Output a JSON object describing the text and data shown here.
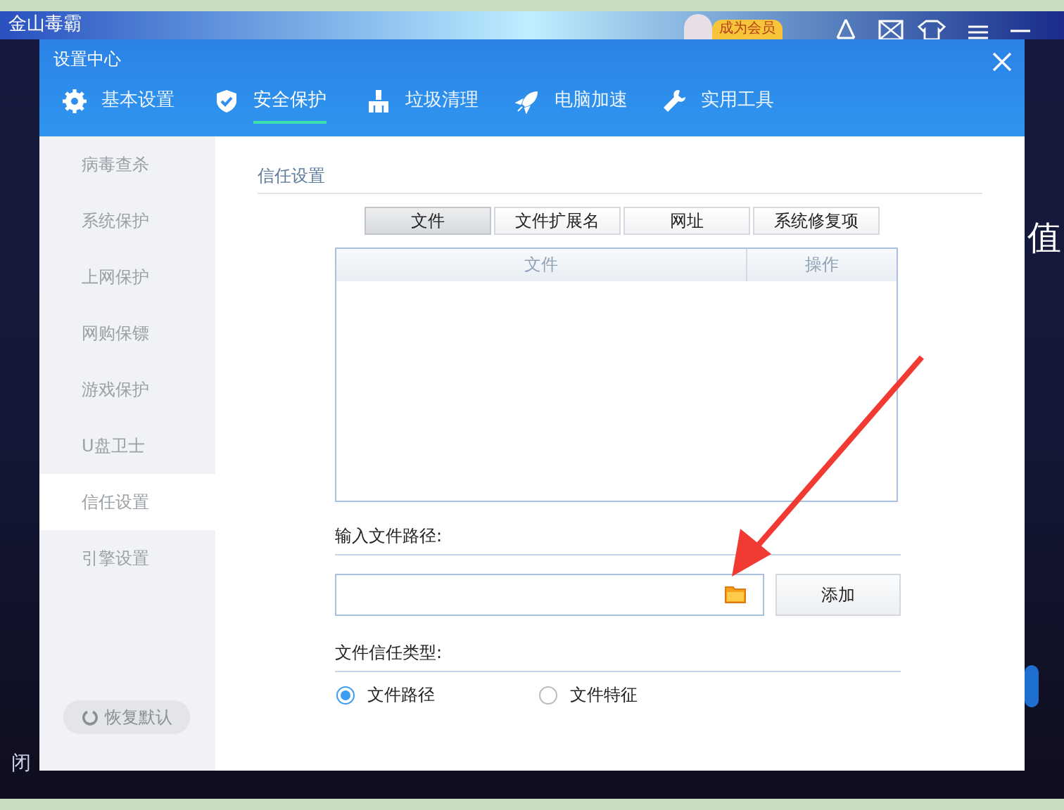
{
  "background": {
    "app_title": "金山毒霸",
    "member_button": "成为会员",
    "side_text": "值",
    "corner_text": "闭"
  },
  "dialog": {
    "title": "设置中心",
    "tabs": [
      {
        "label": "基本设置",
        "kind": "settings",
        "selected": false
      },
      {
        "label": "安全保护",
        "kind": "protection",
        "selected": true
      },
      {
        "label": "垃圾清理",
        "kind": "cleanup",
        "selected": false
      },
      {
        "label": "电脑加速",
        "kind": "speedup",
        "selected": false
      },
      {
        "label": "实用工具",
        "kind": "tools",
        "selected": false
      }
    ],
    "sidebar": {
      "items": [
        {
          "label": "病毒查杀",
          "selected": false
        },
        {
          "label": "系统保护",
          "selected": false
        },
        {
          "label": "上网保护",
          "selected": false
        },
        {
          "label": "网购保镖",
          "selected": false
        },
        {
          "label": "游戏保护",
          "selected": false
        },
        {
          "label": "U盘卫士",
          "selected": false
        },
        {
          "label": "信任设置",
          "selected": true
        },
        {
          "label": "引擎设置",
          "selected": false
        }
      ],
      "restore_button": "恢复默认"
    },
    "section_title": "信任设置",
    "filter_buttons": [
      {
        "label": "文件",
        "selected": true
      },
      {
        "label": "文件扩展名",
        "selected": false
      },
      {
        "label": "网址",
        "selected": false
      },
      {
        "label": "系统修复项",
        "selected": false
      }
    ],
    "table": {
      "columns": [
        "文件",
        "操作"
      ]
    },
    "path_label": "输入文件路径:",
    "add_button": "添加",
    "type_label": "文件信任类型:",
    "trust_types": [
      {
        "label": "文件路径",
        "selected": true
      },
      {
        "label": "文件特征",
        "selected": false
      }
    ]
  }
}
